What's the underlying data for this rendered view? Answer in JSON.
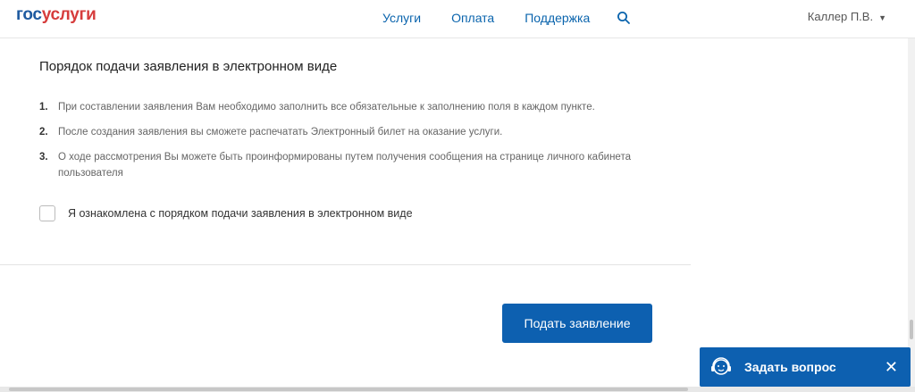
{
  "header": {
    "logo_part1": "гос",
    "logo_part2": "услуги",
    "nav": [
      "Услуги",
      "Оплата",
      "Поддержка"
    ],
    "user_name": "Каллер П.В."
  },
  "main": {
    "title": "Порядок подачи заявления в электронном виде",
    "steps": [
      {
        "num": "1.",
        "text": "При составлении заявления Вам необходимо заполнить все обязательные к заполнению поля в каждом пункте."
      },
      {
        "num": "2.",
        "text": "После создания заявления вы сможете распечатать Электронный билет на оказание услуги."
      },
      {
        "num": "3.",
        "text": "О ходе рассмотрения Вы можете быть проинформированы путем получения сообщения на странице личного кабинета пользователя"
      }
    ],
    "agree_label": "Я ознакомлена с порядком подачи заявления в электронном виде",
    "agree_checked": false,
    "submit_label": "Подать заявление"
  },
  "widget": {
    "ask_label": "Задать вопрос",
    "close_glyph": "✕"
  },
  "icons": {
    "search": "search-icon",
    "chevron": "chevron-down-icon",
    "support": "headset-icon",
    "close": "close-icon"
  },
  "colors": {
    "brand_blue": "#0d60b0",
    "link_blue": "#0a64ad",
    "logo_red": "#d63c3c"
  }
}
